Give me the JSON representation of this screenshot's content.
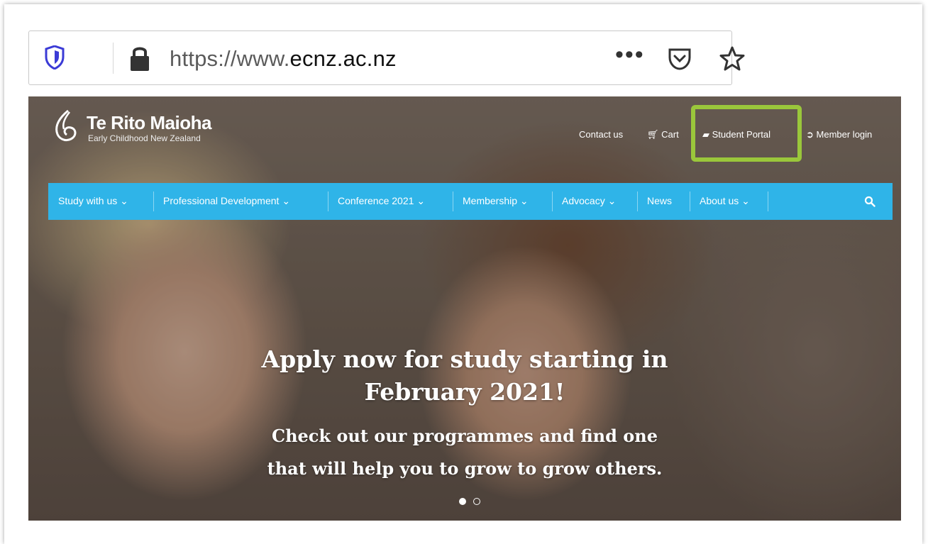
{
  "browser": {
    "url_prefix": "https://www.",
    "url_domain": "ecnz.ac.nz",
    "more_menu": "•••"
  },
  "site": {
    "logo_title": "Te Rito Maioha",
    "logo_subtitle": "Early Childhood New Zealand",
    "top_links": {
      "contact": "Contact us",
      "cart": "Cart",
      "student_portal": "Student Portal",
      "member_login": "Member login"
    },
    "nav": [
      {
        "label": "Study with us",
        "caret": "⌄"
      },
      {
        "label": "Professional Development",
        "caret": "⌄"
      },
      {
        "label": "Conference 2021",
        "caret": "⌄"
      },
      {
        "label": "Membership",
        "caret": "⌄"
      },
      {
        "label": "Advocacy",
        "caret": "⌄"
      },
      {
        "label": "News",
        "caret": ""
      },
      {
        "label": "About us",
        "caret": "⌄"
      }
    ],
    "hero": {
      "headline_line1": "Apply now for study starting in",
      "headline_line2": "February 2021!",
      "sub_line1": "Check out our programmes and find one",
      "sub_line2": "that will help you to grow to grow others."
    }
  },
  "colors": {
    "nav_bg": "#2fb4e8",
    "highlight": "#9ac73b",
    "shield": "#3b3bd6"
  }
}
